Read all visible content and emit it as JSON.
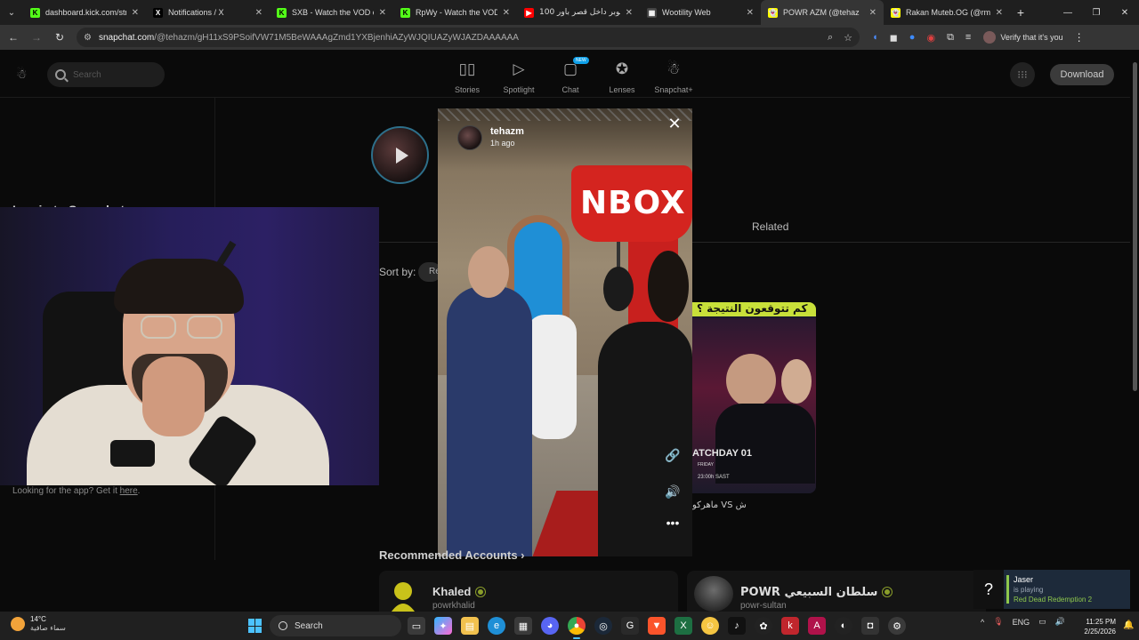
{
  "browser": {
    "tabs": [
      {
        "title": "dashboard.kick.com/strea",
        "fav_color": "#53fc18",
        "fav_glyph": "K",
        "active": false
      },
      {
        "title": "Notifications / X",
        "fav_color": "#000000",
        "fav_glyph": "X",
        "active": false
      },
      {
        "title": "SXB - Watch the VOD on",
        "fav_color": "#53fc18",
        "fav_glyph": "K",
        "active": false
      },
      {
        "title": "RpWy - Watch the VOD o",
        "fav_color": "#53fc18",
        "fav_glyph": "K",
        "active": false
      },
      {
        "title": "100 يوتيوبر داخل قصر باور",
        "fav_color": "#ff0000",
        "fav_glyph": "▶",
        "active": false
      },
      {
        "title": "Wootility Web",
        "fav_color": "#444444",
        "fav_glyph": "▦",
        "active": false
      },
      {
        "title": "POWR AZM (@tehaz",
        "fav_color": "#fffc00",
        "fav_glyph": "👻",
        "active": true
      },
      {
        "title": "Rakan Muteb.OG (@rms",
        "fav_color": "#fffc00",
        "fav_glyph": "👻",
        "active": false
      }
    ],
    "url_host": "snapchat.com",
    "url_path": "/@tehazm/gH11xS9PSoifVW71M5BeWAAAgZmd1YXBjenhiAZyWJQIUAZyWJAZDAAAAAA",
    "verify_label": "Verify that it's you"
  },
  "snapchat": {
    "search_placeholder": "Search",
    "nav": [
      {
        "label": "Stories",
        "icon": "stories-icon",
        "glyph": "▯▯"
      },
      {
        "label": "Spotlight",
        "icon": "spotlight-icon",
        "glyph": "▷"
      },
      {
        "label": "Chat",
        "icon": "chat-icon",
        "glyph": "▢",
        "badge": "NEW"
      },
      {
        "label": "Lenses",
        "icon": "lenses-icon",
        "glyph": "✪"
      },
      {
        "label": "Snapchat+",
        "icon": "snapchat-plus-icon",
        "glyph": "☃"
      }
    ],
    "download_label": "Download",
    "login_text": "Log in to Snapchat",
    "related_tab": "Related",
    "sort_label": "Sort by:",
    "sort_value": "Re",
    "app_note_prefix": "Looking for the app? Get it ",
    "app_note_link": "here",
    "app_note_suffix": ".",
    "recommended_title": "Recommended Accounts ›",
    "accounts": [
      {
        "name": "Khaled",
        "handle": "powrkhalid",
        "verified": true
      },
      {
        "name": "POWR سلطان السبيعي",
        "handle": "powr-sultan",
        "verified": true
      }
    ]
  },
  "story": {
    "username": "tehazm",
    "time": "1h ago",
    "sign_text": "NBOX"
  },
  "related_card": {
    "top_text": "كم تتوقعون النتيجة ؟",
    "match_text": "ATCHDAY 01",
    "day_text": "FRIDAY",
    "time_text": "23:00h SAST",
    "caption": "ماهركو VS ش"
  },
  "steam": {
    "friend": "Jaser",
    "status": "is playing",
    "game": "Red Dead Redemption 2"
  },
  "taskbar": {
    "temp": "14°C",
    "weather": "سماء صافية",
    "search_label": "Search",
    "lang": "ENG",
    "time": "11:25 PM",
    "date": "2/25/2026"
  }
}
